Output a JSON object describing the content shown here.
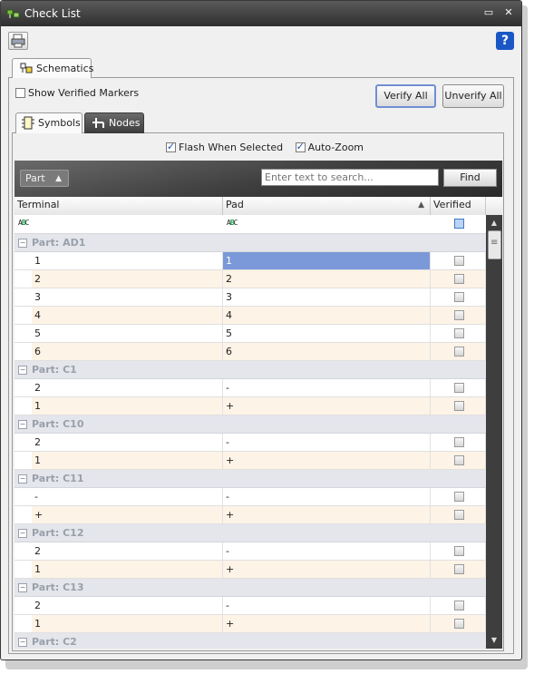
{
  "window": {
    "title": "Check List"
  },
  "tabs": {
    "outer": "Schematics",
    "inner": [
      "Symbols",
      "Nodes"
    ]
  },
  "options": {
    "show_verified": "Show Verified Markers",
    "flash": "Flash When Selected",
    "auto_zoom": "Auto-Zoom"
  },
  "buttons": {
    "verify_all": "Verify All",
    "unverify_all": "Unverify All",
    "find": "Find"
  },
  "group_by": "Part",
  "search": {
    "placeholder": "Enter text to search..."
  },
  "grid": {
    "columns": {
      "terminal": "Terminal",
      "pad": "Pad",
      "verified": "Verified"
    },
    "groups": [
      {
        "label": "Part: AD1",
        "rows": [
          {
            "terminal": "1",
            "pad": "1"
          },
          {
            "terminal": "2",
            "pad": "2"
          },
          {
            "terminal": "3",
            "pad": "3"
          },
          {
            "terminal": "4",
            "pad": "4"
          },
          {
            "terminal": "5",
            "pad": "5"
          },
          {
            "terminal": "6",
            "pad": "6"
          }
        ]
      },
      {
        "label": "Part: C1",
        "rows": [
          {
            "terminal": "2",
            "pad": "-"
          },
          {
            "terminal": "1",
            "pad": "+"
          }
        ]
      },
      {
        "label": "Part: C10",
        "rows": [
          {
            "terminal": "2",
            "pad": "-"
          },
          {
            "terminal": "1",
            "pad": "+"
          }
        ]
      },
      {
        "label": "Part: C11",
        "rows": [
          {
            "terminal": "-",
            "pad": "-"
          },
          {
            "terminal": "+",
            "pad": "+"
          }
        ]
      },
      {
        "label": "Part: C12",
        "rows": [
          {
            "terminal": "2",
            "pad": "-"
          },
          {
            "terminal": "1",
            "pad": "+"
          }
        ]
      },
      {
        "label": "Part: C13",
        "rows": [
          {
            "terminal": "2",
            "pad": "-"
          },
          {
            "terminal": "1",
            "pad": "+"
          }
        ]
      },
      {
        "label": "Part: C2",
        "rows": []
      }
    ]
  }
}
